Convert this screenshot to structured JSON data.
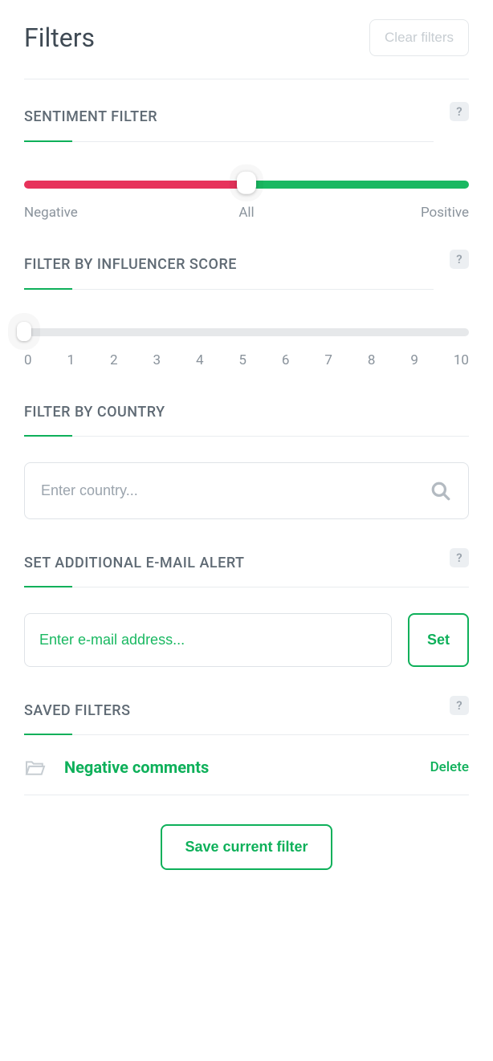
{
  "header": {
    "title": "Filters",
    "clear_label": "Clear filters"
  },
  "sentiment": {
    "title": "SENTIMENT FILTER",
    "help": "?",
    "label_neg": "Negative",
    "label_all": "All",
    "label_pos": "Positive"
  },
  "influencer": {
    "title": "FILTER BY INFLUENCER SCORE",
    "help": "?",
    "ticks": [
      "0",
      "1",
      "2",
      "3",
      "4",
      "5",
      "6",
      "7",
      "8",
      "9",
      "10"
    ]
  },
  "country": {
    "title": "FILTER BY COUNTRY",
    "placeholder": "Enter country..."
  },
  "email_alert": {
    "title": "SET ADDITIONAL E-MAIL ALERT",
    "help": "?",
    "placeholder": "Enter e-mail address...",
    "set_label": "Set"
  },
  "saved": {
    "title": "SAVED FILTERS",
    "help": "?",
    "item_name": "Negative comments",
    "delete_label": "Delete"
  },
  "save_btn": "Save current filter"
}
